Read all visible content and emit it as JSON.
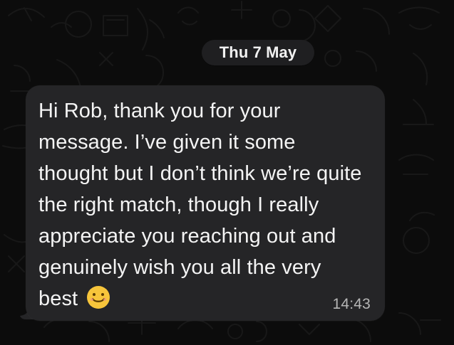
{
  "chat": {
    "date_label": "Thu 7 May",
    "message": {
      "text": "Hi Rob, thank you for your message. I’ve given it some thought but I don’t think we’re quite the right match, though I really appreciate you reaching out and genuinely wish you all the very best",
      "emoji": "smiling-face-icon",
      "time": "14:43"
    }
  },
  "colors": {
    "background": "#0c0c0c",
    "date_pill": "#1f1f21",
    "bubble": "#252527",
    "text": "#f4f4f4",
    "timestamp": "#b6b6b6",
    "emoji": "#f7c53b"
  }
}
